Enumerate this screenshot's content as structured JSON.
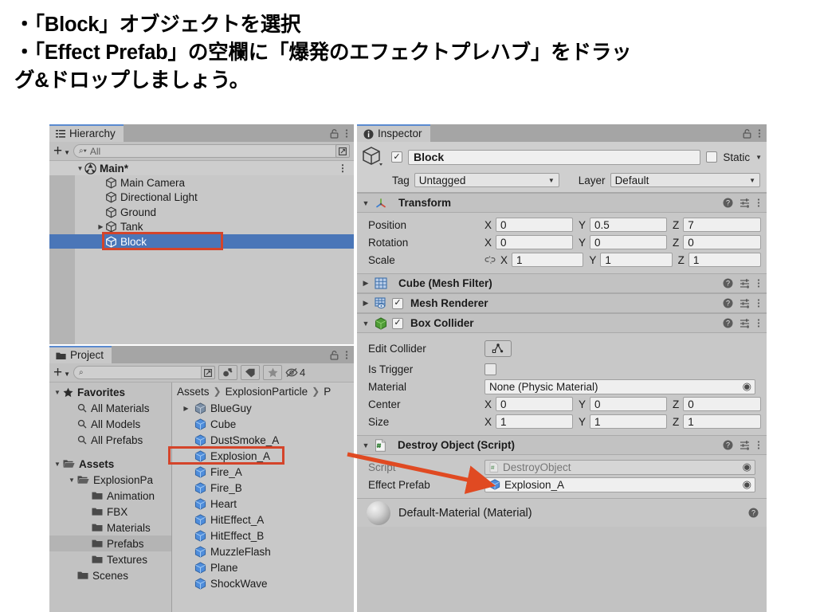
{
  "slide": {
    "lines": [
      "・「Block」オブジェクトを選択",
      "・「Effect Prefab」の空欄に「爆発のエフェクトプレハブ」をドラッ",
      "グ&ドロップしましょう。"
    ]
  },
  "colors": {
    "selection_blue": "#4a76b8",
    "highlight_red": "#d4442a",
    "panel_gray": "#c2c2c2",
    "tab_accent": "#5a8ad0",
    "prefab_blue": "#4f8ddb",
    "collider_green": "#5a9e3f"
  },
  "hierarchy": {
    "tab_label": "Hierarchy",
    "tab_icon": "hierarchy-icon",
    "lock_icon": "lock-icon",
    "menu_icon": "kebab-menu-icon",
    "add_label": "+",
    "search_placeholder": "All",
    "search_value": "",
    "items": [
      {
        "label": "Main*",
        "indent": 0,
        "expand": "down",
        "icon": "unity-scene-icon",
        "bold": true,
        "selected": false,
        "kebab": true
      },
      {
        "label": "Main Camera",
        "indent": 1,
        "expand": "",
        "icon": "gameobject-cube-icon",
        "bold": false,
        "selected": false,
        "kebab": false
      },
      {
        "label": "Directional Light",
        "indent": 1,
        "expand": "",
        "icon": "gameobject-cube-icon",
        "bold": false,
        "selected": false,
        "kebab": false
      },
      {
        "label": "Ground",
        "indent": 1,
        "expand": "",
        "icon": "gameobject-cube-icon",
        "bold": false,
        "selected": false,
        "kebab": false
      },
      {
        "label": "Tank",
        "indent": 1,
        "expand": "right",
        "icon": "gameobject-cube-icon",
        "bold": false,
        "selected": false,
        "kebab": false
      },
      {
        "label": "Block",
        "indent": 1,
        "expand": "",
        "icon": "gameobject-cube-icon",
        "bold": false,
        "selected": true,
        "kebab": false
      }
    ]
  },
  "project": {
    "tab_label": "Project",
    "tab_icon": "folder-icon",
    "lock_icon": "lock-icon",
    "menu_icon": "kebab-menu-icon",
    "add_label": "+",
    "search_placeholder": "",
    "search_value": "",
    "toolbar_icons": [
      "asset-filter-icon",
      "label-tag-icon",
      "favorite-star-icon",
      "hidden-eye-icon"
    ],
    "hidden_count": "4",
    "tree": [
      {
        "label": "Favorites",
        "indent": 0,
        "expand": "down",
        "icon": "star-icon",
        "bold": true,
        "highlight": false
      },
      {
        "label": "All Materials",
        "indent": 1,
        "expand": "",
        "icon": "search-small-icon",
        "bold": false,
        "highlight": false
      },
      {
        "label": "All Models",
        "indent": 1,
        "expand": "",
        "icon": "search-small-icon",
        "bold": false,
        "highlight": false
      },
      {
        "label": "All Prefabs",
        "indent": 1,
        "expand": "",
        "icon": "search-small-icon",
        "bold": false,
        "highlight": false
      },
      {
        "label": "",
        "indent": 0,
        "expand": "",
        "icon": "",
        "bold": false,
        "highlight": false
      },
      {
        "label": "Assets",
        "indent": 0,
        "expand": "down",
        "icon": "folder-open-icon",
        "bold": true,
        "highlight": false
      },
      {
        "label": "ExplosionPa",
        "indent": 1,
        "expand": "down",
        "icon": "folder-open-icon",
        "bold": false,
        "highlight": false
      },
      {
        "label": "Animation",
        "indent": 2,
        "expand": "",
        "icon": "folder-icon",
        "bold": false,
        "highlight": false
      },
      {
        "label": "FBX",
        "indent": 2,
        "expand": "",
        "icon": "folder-icon",
        "bold": false,
        "highlight": false
      },
      {
        "label": "Materials",
        "indent": 2,
        "expand": "",
        "icon": "folder-icon",
        "bold": false,
        "highlight": false
      },
      {
        "label": "Prefabs",
        "indent": 2,
        "expand": "",
        "icon": "folder-icon",
        "bold": false,
        "highlight": true
      },
      {
        "label": "Textures",
        "indent": 2,
        "expand": "",
        "icon": "folder-icon",
        "bold": false,
        "highlight": false
      },
      {
        "label": "Scenes",
        "indent": 1,
        "expand": "",
        "icon": "folder-icon",
        "bold": false,
        "highlight": false
      }
    ],
    "breadcrumb": [
      "Assets",
      "ExplosionParticle",
      "P"
    ],
    "assets": [
      {
        "label": "BlueGuy",
        "icon": "prefab-variant-icon",
        "expand": "right",
        "selected": false
      },
      {
        "label": "Cube",
        "icon": "prefab-icon",
        "expand": "",
        "selected": false
      },
      {
        "label": "DustSmoke_A",
        "icon": "prefab-icon",
        "expand": "",
        "selected": false
      },
      {
        "label": "Explosion_A",
        "icon": "prefab-icon",
        "expand": "",
        "selected": true
      },
      {
        "label": "Fire_A",
        "icon": "prefab-icon",
        "expand": "",
        "selected": false
      },
      {
        "label": "Fire_B",
        "icon": "prefab-icon",
        "expand": "",
        "selected": false
      },
      {
        "label": "Heart",
        "icon": "prefab-icon",
        "expand": "",
        "selected": false
      },
      {
        "label": "HitEffect_A",
        "icon": "prefab-icon",
        "expand": "",
        "selected": false
      },
      {
        "label": "HitEffect_B",
        "icon": "prefab-icon",
        "expand": "",
        "selected": false
      },
      {
        "label": "MuzzleFlash",
        "icon": "prefab-icon",
        "expand": "",
        "selected": false
      },
      {
        "label": "Plane",
        "icon": "prefab-icon",
        "expand": "",
        "selected": false
      },
      {
        "label": "ShockWave",
        "icon": "prefab-icon",
        "expand": "",
        "selected": false
      }
    ]
  },
  "inspector": {
    "tab_label": "Inspector",
    "tab_icon": "info-icon",
    "lock_icon": "lock-icon",
    "menu_icon": "kebab-menu-icon",
    "object": {
      "icon": "gameobject-cube-icon",
      "enabled_checked": true,
      "name": "Block",
      "static_label": "Static",
      "static_checked": false,
      "tag_label": "Tag",
      "tag_value": "Untagged",
      "layer_label": "Layer",
      "layer_value": "Default"
    },
    "transform": {
      "title": "Transform",
      "icon": "transform-axes-icon",
      "expanded": true,
      "rows": [
        {
          "name": "Position",
          "link_icon": "",
          "x": "0",
          "y": "0.5",
          "z": "7"
        },
        {
          "name": "Rotation",
          "link_icon": "",
          "x": "0",
          "y": "0",
          "z": "0"
        },
        {
          "name": "Scale",
          "link_icon": "broken-link-icon",
          "x": "1",
          "y": "1",
          "z": "1"
        }
      ]
    },
    "components": [
      {
        "title": "Cube (Mesh Filter)",
        "icon": "mesh-filter-icon",
        "expanded": false,
        "has_checkbox": false,
        "checked": false
      },
      {
        "title": "Mesh Renderer",
        "icon": "mesh-renderer-icon",
        "expanded": false,
        "has_checkbox": true,
        "checked": true
      }
    ],
    "box_collider": {
      "title": "Box Collider",
      "icon": "box-collider-icon",
      "expanded": true,
      "has_checkbox": true,
      "checked": true,
      "edit_collider_label": "Edit Collider",
      "edit_collider_icon": "edit-collider-icon",
      "is_trigger_label": "Is Trigger",
      "is_trigger_checked": false,
      "material_label": "Material",
      "material_value": "None (Physic Material)",
      "center_label": "Center",
      "center": {
        "x": "0",
        "y": "0",
        "z": "0"
      },
      "size_label": "Size",
      "size": {
        "x": "1",
        "y": "1",
        "z": "1"
      }
    },
    "destroy_object": {
      "title": "Destroy Object (Script)",
      "icon": "csharp-script-icon",
      "expanded": true,
      "script_label": "Script",
      "script_value": "DestroyObject",
      "effect_prefab_label": "Effect Prefab",
      "effect_prefab_value": "Explosion_A",
      "effect_prefab_icon": "prefab-icon"
    },
    "material_preview": {
      "title": "Default-Material (Material)",
      "icon": "material-sphere-icon",
      "help_icon": "help-icon"
    },
    "help_icon": "help-icon",
    "preset_icon": "preset-icon",
    "menu_icon_component": "kebab-menu-icon"
  },
  "annotations": {
    "highlight_block_row": true,
    "highlight_explosion_asset": true,
    "drag_arrow": {
      "from": "Explosion_A asset in Project panel",
      "to": "Effect Prefab field in Destroy Object (Script)"
    }
  }
}
